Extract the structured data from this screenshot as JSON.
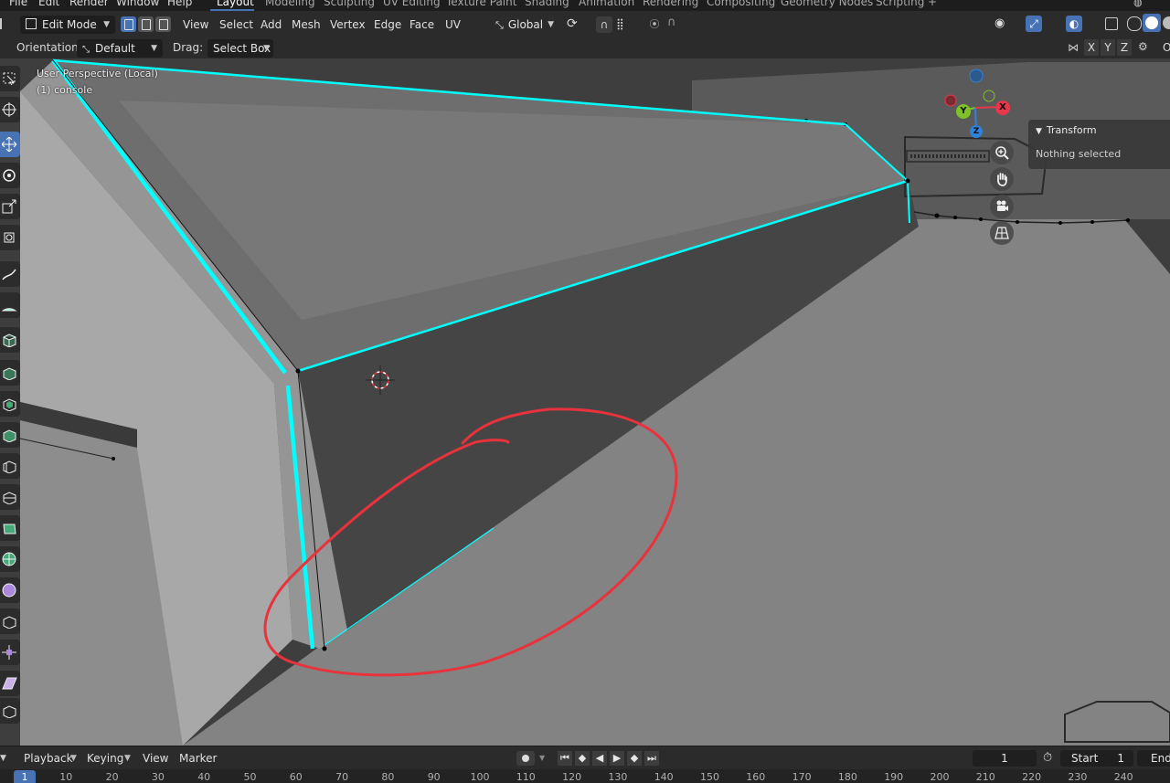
{
  "menubar": {
    "menus": [
      "File",
      "Edit",
      "Render",
      "Window",
      "Help"
    ],
    "workspaces": [
      "Layout",
      "Modeling",
      "Sculpting",
      "UV Editing",
      "Texture Paint",
      "Shading",
      "Animation",
      "Rendering",
      "Compositing",
      "Geometry Nodes",
      "Scripting"
    ],
    "active_workspace": "Layout",
    "add_tab": "+"
  },
  "header": {
    "mode": "Edit Mode",
    "menus": [
      "View",
      "Select",
      "Add",
      "Mesh",
      "Vertex",
      "Edge",
      "Face",
      "UV"
    ],
    "transform_orientation": "Global"
  },
  "toolsettings": {
    "orientation_label": "Orientation:",
    "orientation_value": "Default",
    "drag_label": "Drag:",
    "drag_value": "Select Box",
    "axes": [
      "X",
      "Y",
      "Z"
    ],
    "options_label": "O"
  },
  "viewport": {
    "view_name": "User Perspective (Local)",
    "object_name": "(1) console",
    "gizmo_axes": [
      "Y",
      "X",
      "Z"
    ],
    "colors": {
      "selected_edge": "#00ffff",
      "annotation": "#e8323c",
      "axis_x": "#e8374a",
      "axis_y": "#7fc126",
      "axis_z": "#2f82dc"
    }
  },
  "npanel": {
    "title": "Transform",
    "message": "Nothing selected"
  },
  "timeline": {
    "menus": [
      "Playback",
      "Keying",
      "View",
      "Marker"
    ],
    "current_frame": "1",
    "start_label": "Start",
    "start_value": "1",
    "end_label": "End",
    "ruler_ticks": [
      "1",
      "10",
      "20",
      "30",
      "40",
      "50",
      "60",
      "70",
      "80",
      "90",
      "100",
      "110",
      "120",
      "130",
      "140",
      "150",
      "160",
      "170",
      "180",
      "190",
      "200",
      "210",
      "220",
      "230",
      "240"
    ]
  }
}
